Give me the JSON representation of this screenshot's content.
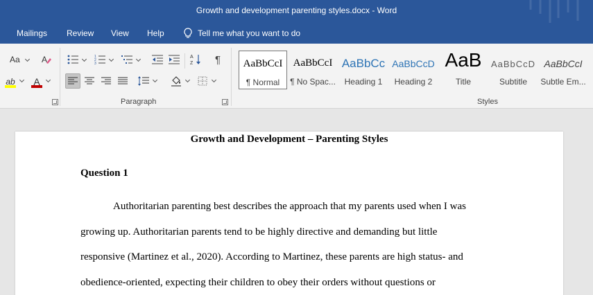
{
  "window": {
    "title": "Growth and development parenting styles.docx  -  Word"
  },
  "menu": {
    "tabs": [
      "Mailings",
      "Review",
      "View",
      "Help"
    ],
    "tell_me": "Tell me what you want to do"
  },
  "ribbon": {
    "font_group": {
      "case_label": "Aa",
      "highlight_letter": "ab",
      "font_color_letter": "A",
      "highlight_color": "#ffff00",
      "font_color": "#c00000"
    },
    "paragraph_group": {
      "label": "Paragraph",
      "pilcrow": "¶"
    },
    "styles_group": {
      "label": "Styles",
      "items": [
        {
          "sample": "AaBbCcI",
          "name": "¶ Normal",
          "selected": true
        },
        {
          "sample": "AaBbCcI",
          "name": "¶ No Spac..."
        },
        {
          "sample": "AaBbCc",
          "name": "Heading 1"
        },
        {
          "sample": "AaBbCcD",
          "name": "Heading 2"
        },
        {
          "sample": "AaB",
          "name": "Title"
        },
        {
          "sample": "AaBbCcD",
          "name": "Subtitle"
        },
        {
          "sample": "AaBbCcI",
          "name": "Subtle Em..."
        }
      ]
    }
  },
  "document": {
    "title": "Growth and Development – Parenting Styles",
    "heading": "Question 1",
    "lines": [
      "Authoritarian parenting best describes the approach that my parents used when I was",
      "growing up. Authoritarian parents tend to be highly directive and demanding but little",
      "responsive (Martinez et al., 2020). According to Martinez, these parents are high status- and",
      "obedience-oriented, expecting their children to obey their orders without questions or"
    ]
  },
  "colors": {
    "title_bar": "#2b579a",
    "ribbon_bg": "#f3f3f3",
    "workspace": "#e6e6e6"
  }
}
